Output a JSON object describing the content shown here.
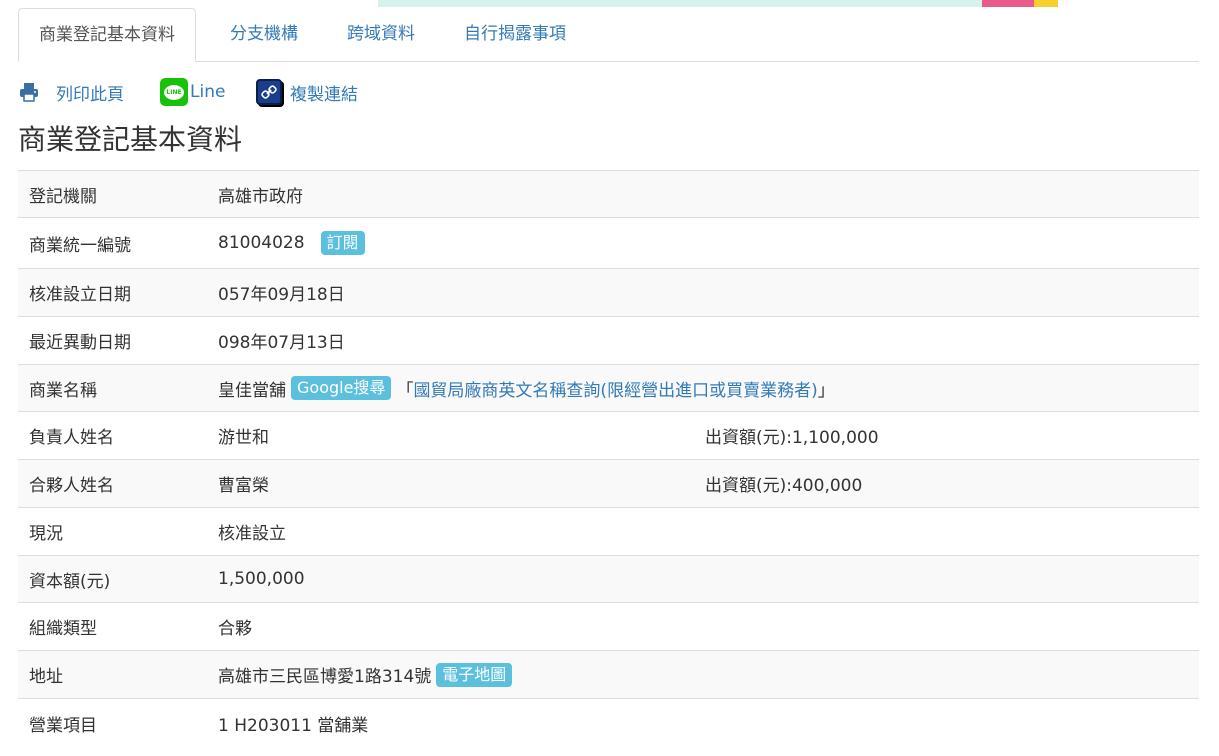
{
  "tabs": [
    {
      "label": "商業登記基本資料"
    },
    {
      "label": "分支機構"
    },
    {
      "label": "跨域資料"
    },
    {
      "label": "自行揭露事項"
    }
  ],
  "toolbar": {
    "print_label": "列印此頁",
    "line_label": "Line",
    "line_icon_text": "LINE",
    "copy_label": "複製連結"
  },
  "page_title": "商業登記基本資料",
  "rows": {
    "authority": {
      "label": "登記機關",
      "value": "高雄市政府"
    },
    "business_id": {
      "label": "商業統一編號",
      "value": "81004028",
      "badge": "訂閱"
    },
    "approved_date": {
      "label": "核准設立日期",
      "value": "057年09月18日"
    },
    "changed_date": {
      "label": "最近異動日期",
      "value": "098年07月13日"
    },
    "business_name": {
      "label": "商業名稱",
      "value": "皇佳當舖",
      "badge": "Google搜尋",
      "open_bracket": "「",
      "link": "國貿局廠商英文名稱查詢(限經營出進口或買賣業務者)",
      "close_bracket": "」"
    },
    "responsible": {
      "label": "負責人姓名",
      "value": "游世和",
      "extra": "出資額(元):1,100,000"
    },
    "partner": {
      "label": "合夥人姓名",
      "value": "曹富榮",
      "extra": "出資額(元):400,000"
    },
    "status": {
      "label": "現況",
      "value": "核准設立"
    },
    "capital": {
      "label": "資本額(元)",
      "value": "1,500,000"
    },
    "org_type": {
      "label": "組織類型",
      "value": "合夥"
    },
    "address": {
      "label": "地址",
      "value": "高雄市三民區博愛1路314號",
      "badge": "電子地圖"
    },
    "items": {
      "label": "營業項目",
      "value": "1 H203011 當舖業"
    }
  },
  "colors": {
    "link": "#337ab7",
    "badge": "#5bc0de",
    "line_green": "#19c20a",
    "stripe": "#f9f9f9",
    "border": "#dddddd"
  }
}
